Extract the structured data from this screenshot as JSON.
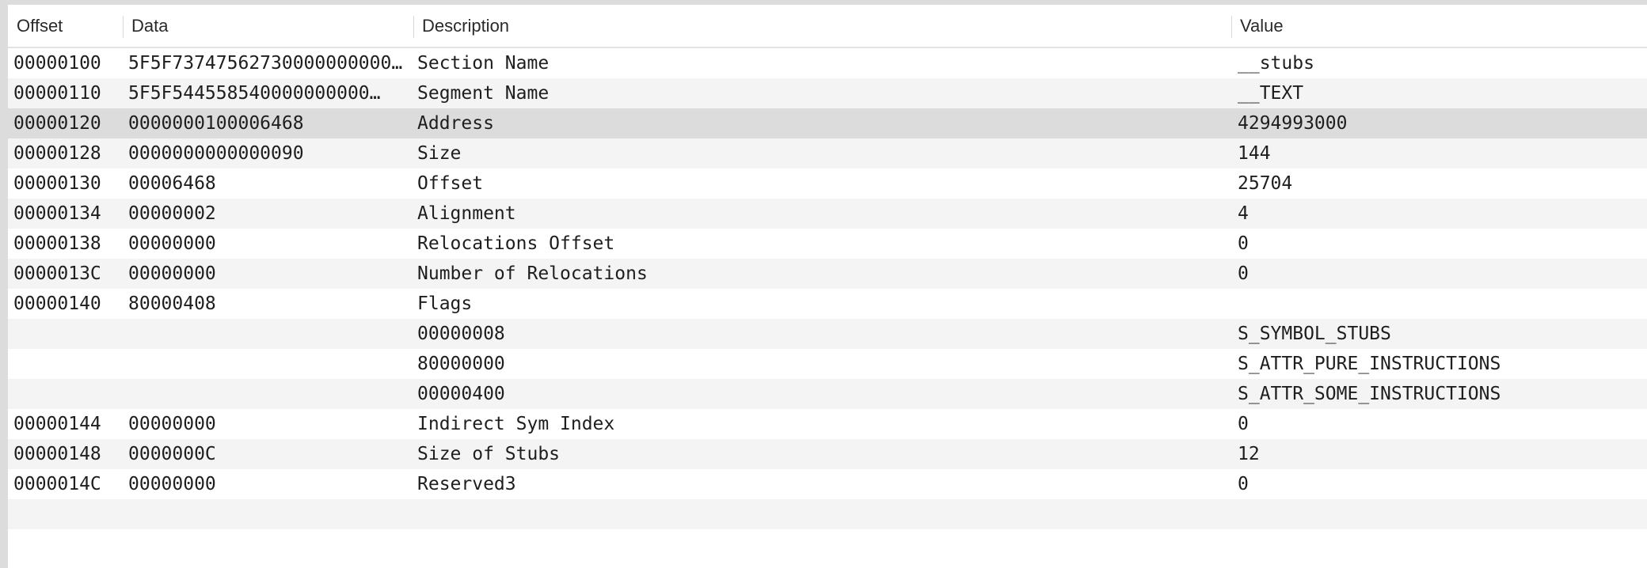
{
  "columns": {
    "offset": "Offset",
    "data": "Data",
    "description": "Description",
    "value": "Value"
  },
  "rows": [
    {
      "offset": "00000100",
      "data": "5F5F73747562730000000000…",
      "description": "Section Name",
      "value": "__stubs"
    },
    {
      "offset": "00000110",
      "data": "5F5F544558540000000000…",
      "description": "Segment Name",
      "value": "__TEXT"
    },
    {
      "offset": "00000120",
      "data": "0000000100006468",
      "description": "Address",
      "value": "4294993000",
      "selected": true
    },
    {
      "offset": "00000128",
      "data": "0000000000000090",
      "description": "Size",
      "value": "144"
    },
    {
      "offset": "00000130",
      "data": "00006468",
      "description": "Offset",
      "value": "25704"
    },
    {
      "offset": "00000134",
      "data": "00000002",
      "description": "Alignment",
      "value": "4"
    },
    {
      "offset": "00000138",
      "data": "00000000",
      "description": "Relocations Offset",
      "value": "0"
    },
    {
      "offset": "0000013C",
      "data": "00000000",
      "description": "Number of Relocations",
      "value": "0"
    },
    {
      "offset": "00000140",
      "data": "80000408",
      "description": "Flags",
      "value": ""
    },
    {
      "offset": "",
      "data": "",
      "description": "00000008",
      "value": "S_SYMBOL_STUBS"
    },
    {
      "offset": "",
      "data": "",
      "description": "80000000",
      "value": "S_ATTR_PURE_INSTRUCTIONS"
    },
    {
      "offset": "",
      "data": "",
      "description": "00000400",
      "value": "S_ATTR_SOME_INSTRUCTIONS"
    },
    {
      "offset": "00000144",
      "data": "00000000",
      "description": "Indirect Sym Index",
      "value": "0"
    },
    {
      "offset": "00000148",
      "data": "0000000C",
      "description": "Size of Stubs",
      "value": "12"
    },
    {
      "offset": "0000014C",
      "data": "00000000",
      "description": "Reserved3",
      "value": "0"
    },
    {
      "offset": "",
      "data": "",
      "description": "",
      "value": ""
    },
    {
      "offset": "",
      "data": "",
      "description": "",
      "value": ""
    }
  ],
  "colors": {
    "alternate_row": "#f4f4f4",
    "selected_row": "#dcdcdc"
  }
}
